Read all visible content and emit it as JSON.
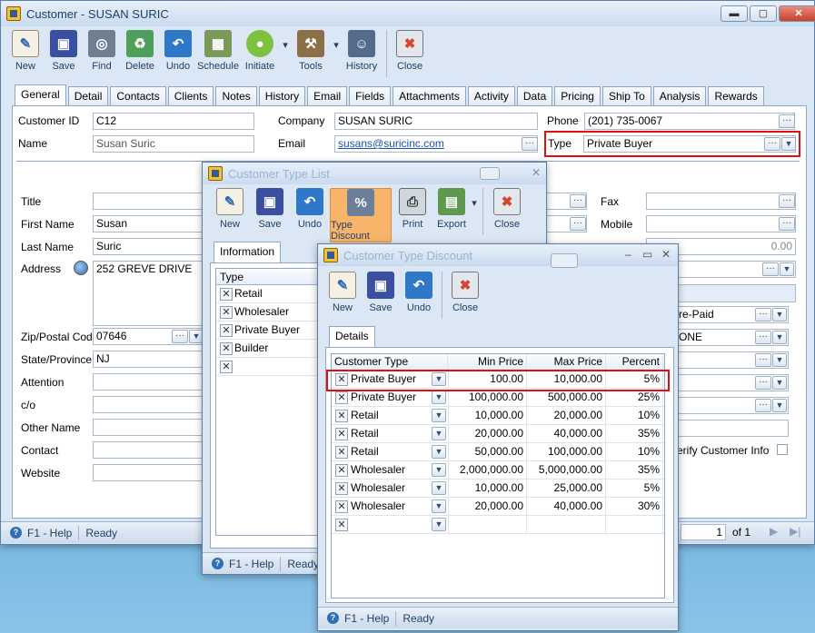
{
  "main": {
    "title": "Customer - SUSAN SURIC",
    "toolbar": [
      "New",
      "Save",
      "Find",
      "Delete",
      "Undo",
      "Schedule",
      "Initiate",
      "Tools",
      "History",
      "Close"
    ],
    "tabs": [
      "General",
      "Detail",
      "Contacts",
      "Clients",
      "Notes",
      "History",
      "Email",
      "Fields",
      "Attachments",
      "Activity",
      "Data",
      "Pricing",
      "Ship To",
      "Analysis",
      "Rewards"
    ],
    "fields": {
      "customer_id_label": "Customer ID",
      "customer_id": "C12",
      "company_label": "Company",
      "company": "SUSAN SURIC",
      "phone_label": "Phone",
      "phone": "(201) 735-0067",
      "name_label": "Name",
      "name": "Susan Suric",
      "email_label": "Email",
      "email": "susans@suricinc.com",
      "type_label": "Type",
      "type": "Private Buyer"
    },
    "left_labels": {
      "title": "Title",
      "first_name": "First Name",
      "last_name": "Last Name",
      "address": "Address",
      "zip": "Zip/Postal Code",
      "state": "State/Province",
      "attention": "Attention",
      "co": "c/o",
      "other_name": "Other Name",
      "contact": "Contact",
      "website": "Website"
    },
    "left_values": {
      "first_name": "Susan",
      "last_name": "Suric",
      "address": "252 GREVE DRIVE",
      "zip": "07646",
      "state": "NJ"
    },
    "right_labels": {
      "fax": "Fax",
      "mobile": "Mobile",
      "verify": "erify Customer Info"
    },
    "right_values": {
      "amount": "0.00",
      "terms": "re-Paid",
      "ship": "ONE"
    },
    "status": {
      "help": "F1 - Help",
      "state": "Ready",
      "page": "1",
      "of": "of 1"
    }
  },
  "type_list": {
    "title": "Customer Type List",
    "toolbar": [
      "New",
      "Save",
      "Undo",
      "Type Discount",
      "Print",
      "Export",
      "Close"
    ],
    "tab": "Information",
    "column": "Type",
    "rows": [
      "Retail",
      "Wholesaler",
      "Private Buyer",
      "Builder",
      ""
    ],
    "status": {
      "help": "F1 - Help",
      "state": "Ready"
    }
  },
  "discount": {
    "title": "Customer Type Discount",
    "toolbar": [
      "New",
      "Save",
      "Undo",
      "Close"
    ],
    "tab": "Details",
    "columns": [
      "Customer Type",
      "Min Price",
      "Max Price",
      "Percent"
    ],
    "rows": [
      {
        "type": "Private Buyer",
        "min": "100.00",
        "max": "10,000.00",
        "pct": "5%"
      },
      {
        "type": "Private Buyer",
        "min": "100,000.00",
        "max": "500,000.00",
        "pct": "25%"
      },
      {
        "type": "Retail",
        "min": "10,000.00",
        "max": "20,000.00",
        "pct": "10%"
      },
      {
        "type": "Retail",
        "min": "20,000.00",
        "max": "40,000.00",
        "pct": "35%"
      },
      {
        "type": "Retail",
        "min": "50,000.00",
        "max": "100,000.00",
        "pct": "10%"
      },
      {
        "type": "Wholesaler",
        "min": "2,000,000.00",
        "max": "5,000,000.00",
        "pct": "35%"
      },
      {
        "type": "Wholesaler",
        "min": "10,000.00",
        "max": "25,000.00",
        "pct": "5%"
      },
      {
        "type": "Wholesaler",
        "min": "20,000.00",
        "max": "40,000.00",
        "pct": "30%"
      },
      {
        "type": "",
        "min": "",
        "max": "",
        "pct": ""
      }
    ],
    "status": {
      "help": "F1 - Help",
      "state": "Ready"
    }
  },
  "colors": {
    "highlight": "#e01010",
    "title_text": "#1f3f66",
    "window_bg": "#dbe7f4"
  }
}
